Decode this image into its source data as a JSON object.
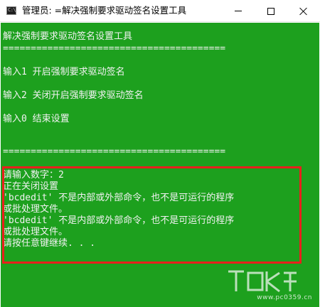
{
  "window": {
    "icon_label": "C:\\",
    "title": "管理员: =解决强制要求驱动签名设置工具",
    "controls": {
      "minimize": "minimize",
      "maximize": "maximize",
      "close": "close"
    }
  },
  "console": {
    "background": "#1da01e",
    "text_color": "#f2f2f2",
    "header": "解决强制要求驱动签名设置工具",
    "separator": "========================================",
    "options": [
      "输入1 开启强制要求驱动签名",
      "输入2 关闭开启强制要求驱动签名",
      "输入0 结束设置"
    ],
    "separator_bottom": "========================================",
    "output": [
      "请输入数字：2",
      "正在关闭设置",
      "'bcdedit' 不是内部或外部命令，也不是可运行的程序",
      "或批处理文件。",
      "'bcdedit' 不是内部或外部命令，也不是可运行的程序",
      "或批处理文件。",
      "请按任意键继续. . ."
    ],
    "highlight_color": "#e8201c"
  },
  "watermark": {
    "text": "www.pc0359.cn"
  }
}
